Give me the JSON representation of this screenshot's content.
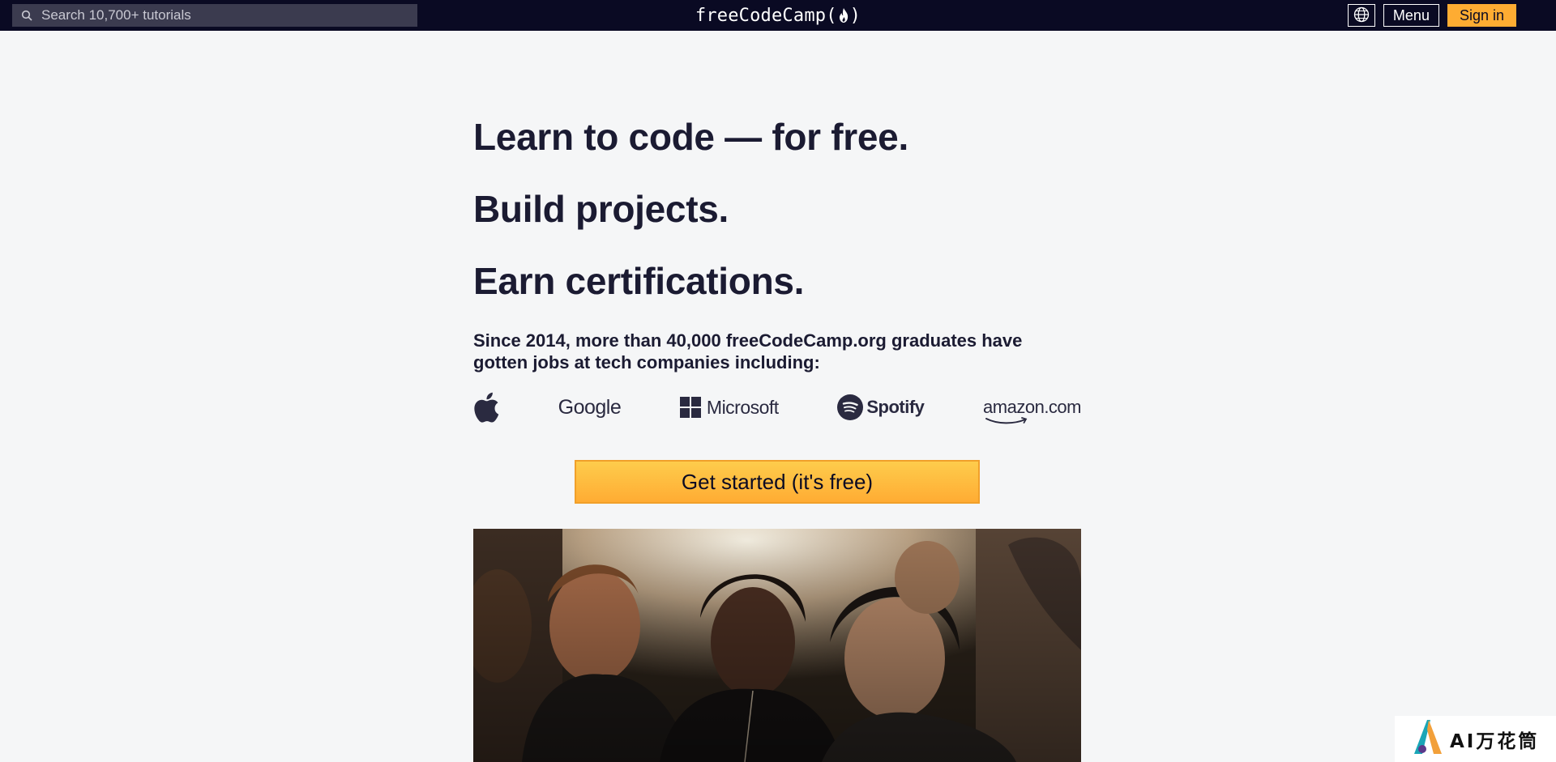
{
  "nav": {
    "search_placeholder": "Search 10,700+ tutorials",
    "brand_left": "freeCodeCamp(",
    "brand_right": ")",
    "menu_label": "Menu",
    "signin_label": "Sign in",
    "colors": {
      "bar": "#0a0a23",
      "search_bg": "#3b3b4f",
      "signin": "#feac32"
    }
  },
  "hero": {
    "line1": "Learn to code — for free.",
    "line2": "Build projects.",
    "line3": "Earn certifications.",
    "subtitle": "Since 2014, more than 40,000 freeCodeCamp.org graduates have gotten jobs at tech companies including:"
  },
  "companies": [
    {
      "name": "Apple",
      "icon": "apple-logo-icon"
    },
    {
      "name": "Google",
      "icon": "google-wordmark"
    },
    {
      "name": "Microsoft",
      "icon": "microsoft-logo-icon"
    },
    {
      "name": "Spotify",
      "icon": "spotify-logo-icon"
    },
    {
      "name": "amazon.com",
      "icon": "amazon-wordmark"
    }
  ],
  "cta": {
    "label": "Get started (it's free)"
  },
  "watermark": {
    "text": "AI万花筒"
  }
}
